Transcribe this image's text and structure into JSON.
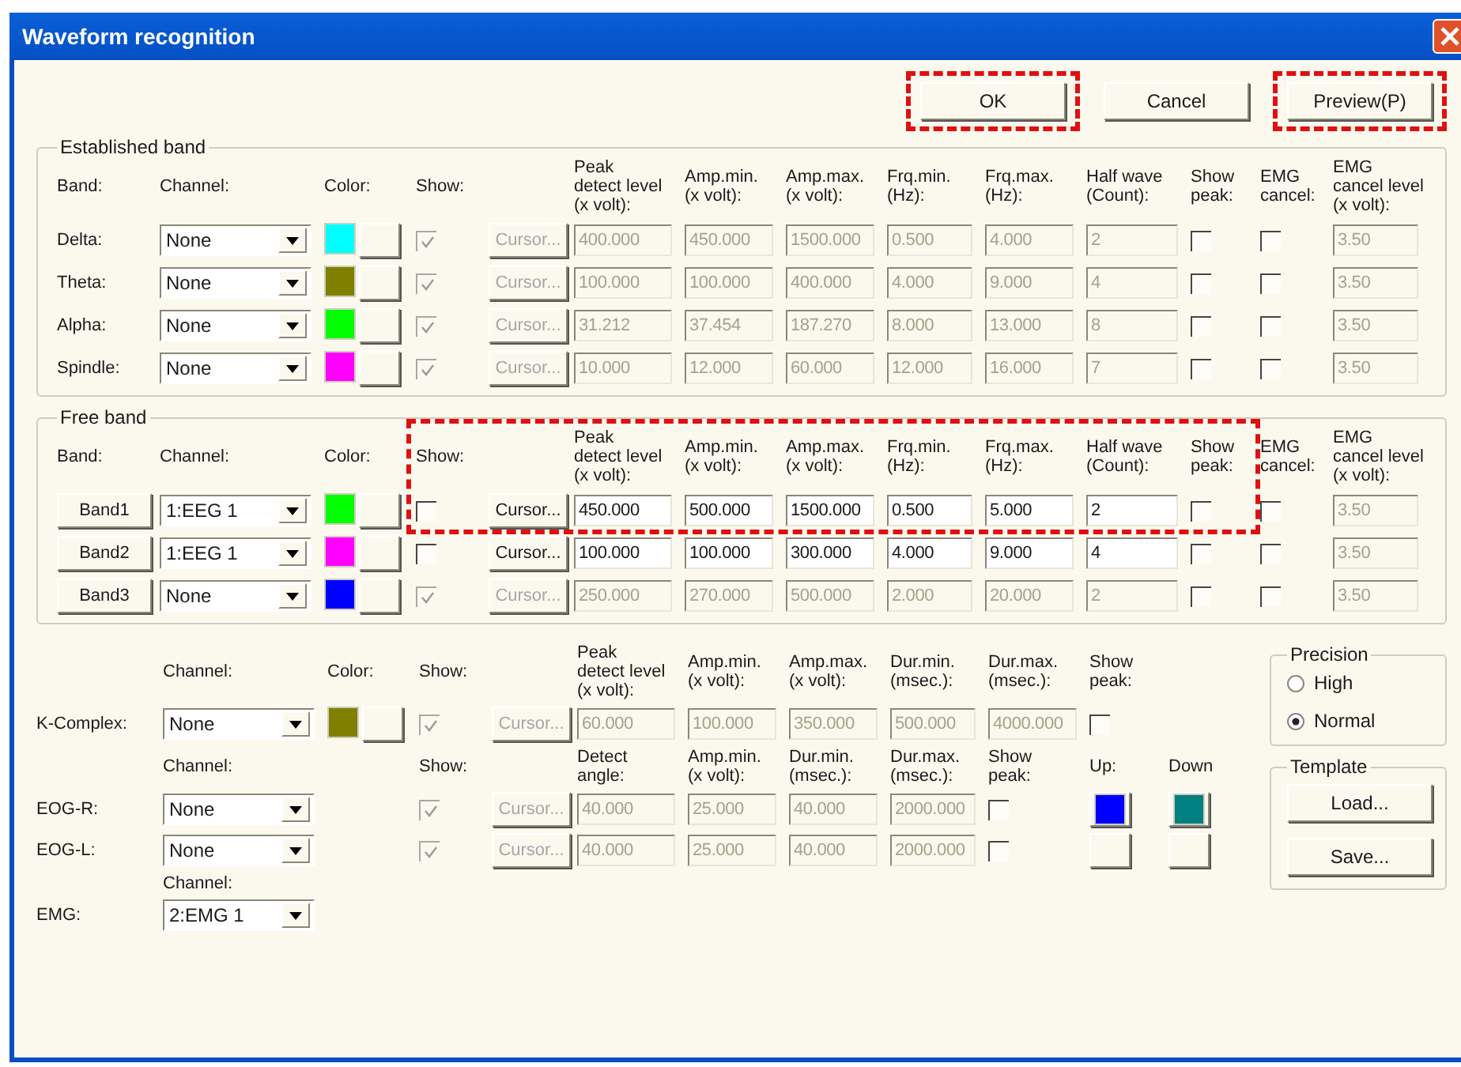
{
  "window": {
    "title": "Waveform recognition"
  },
  "buttons": [
    {
      "label": "OK",
      "highlighted": true
    },
    {
      "label": "Cancel",
      "highlighted": false
    },
    {
      "label": "Preview(P)",
      "highlighted": true
    }
  ],
  "established_band": {
    "title": "Established band",
    "rows": [
      [
        {
          "kind": "header",
          "text": "Band:"
        },
        {
          "kind": "header",
          "text": "Channel:"
        },
        {
          "kind": "header",
          "text": "Color:"
        },
        {
          "kind": "header",
          "text": "Show:"
        },
        {
          "kind": "blank"
        },
        {
          "kind": "header",
          "text": "Peak\ndetect level\n(x volt):"
        },
        {
          "kind": "header",
          "text": "Amp.min.\n(x volt):"
        },
        {
          "kind": "header",
          "text": "Amp.max.\n(x volt):"
        },
        {
          "kind": "header",
          "text": "Frq.min.\n(Hz):"
        },
        {
          "kind": "header",
          "text": "Frq.max.\n(Hz):"
        },
        {
          "kind": "header",
          "text": "Half wave\n(Count):"
        },
        {
          "kind": "header",
          "text": "Show\npeak:"
        },
        {
          "kind": "header",
          "text": "EMG\ncancel:"
        },
        {
          "kind": "header",
          "text": "EMG\ncancel level\n(x volt):"
        }
      ],
      [
        {
          "kind": "label",
          "text": "Delta:"
        },
        {
          "kind": "combo",
          "value": "None"
        },
        {
          "kind": "color",
          "color": "#00ffff"
        },
        {
          "kind": "check",
          "checked": true,
          "disabled": true
        },
        {
          "kind": "cursor",
          "text": "Cursor...",
          "disabled": true
        },
        {
          "kind": "field",
          "value": "400.000",
          "disabled": true
        },
        {
          "kind": "field",
          "value": "450.000",
          "disabled": true
        },
        {
          "kind": "field",
          "value": "1500.000",
          "disabled": true
        },
        {
          "kind": "field",
          "value": "0.500",
          "disabled": true
        },
        {
          "kind": "field",
          "value": "4.000",
          "disabled": true
        },
        {
          "kind": "field",
          "value": "2",
          "disabled": true
        },
        {
          "kind": "check",
          "checked": false,
          "disabled": false
        },
        {
          "kind": "check",
          "checked": false,
          "disabled": false
        },
        {
          "kind": "field",
          "value": "3.50",
          "disabled": true
        }
      ],
      [
        {
          "kind": "label",
          "text": "Theta:"
        },
        {
          "kind": "combo",
          "value": "None"
        },
        {
          "kind": "color",
          "color": "#808000"
        },
        {
          "kind": "check",
          "checked": true,
          "disabled": true
        },
        {
          "kind": "cursor",
          "text": "Cursor...",
          "disabled": true
        },
        {
          "kind": "field",
          "value": "100.000",
          "disabled": true
        },
        {
          "kind": "field",
          "value": "100.000",
          "disabled": true
        },
        {
          "kind": "field",
          "value": "400.000",
          "disabled": true
        },
        {
          "kind": "field",
          "value": "4.000",
          "disabled": true
        },
        {
          "kind": "field",
          "value": "9.000",
          "disabled": true
        },
        {
          "kind": "field",
          "value": "4",
          "disabled": true
        },
        {
          "kind": "check",
          "checked": false,
          "disabled": false
        },
        {
          "kind": "check",
          "checked": false,
          "disabled": false
        },
        {
          "kind": "field",
          "value": "3.50",
          "disabled": true
        }
      ],
      [
        {
          "kind": "label",
          "text": "Alpha:"
        },
        {
          "kind": "combo",
          "value": "None"
        },
        {
          "kind": "color",
          "color": "#00ff00"
        },
        {
          "kind": "check",
          "checked": true,
          "disabled": true
        },
        {
          "kind": "cursor",
          "text": "Cursor...",
          "disabled": true
        },
        {
          "kind": "field",
          "value": "31.212",
          "disabled": true
        },
        {
          "kind": "field",
          "value": "37.454",
          "disabled": true
        },
        {
          "kind": "field",
          "value": "187.270",
          "disabled": true
        },
        {
          "kind": "field",
          "value": "8.000",
          "disabled": true
        },
        {
          "kind": "field",
          "value": "13.000",
          "disabled": true
        },
        {
          "kind": "field",
          "value": "8",
          "disabled": true
        },
        {
          "kind": "check",
          "checked": false,
          "disabled": false
        },
        {
          "kind": "check",
          "checked": false,
          "disabled": false
        },
        {
          "kind": "field",
          "value": "3.50",
          "disabled": true
        }
      ],
      [
        {
          "kind": "label",
          "text": "Spindle:"
        },
        {
          "kind": "combo",
          "value": "None"
        },
        {
          "kind": "color",
          "color": "#ff00ff"
        },
        {
          "kind": "check",
          "checked": true,
          "disabled": true
        },
        {
          "kind": "cursor",
          "text": "Cursor...",
          "disabled": true
        },
        {
          "kind": "field",
          "value": "10.000",
          "disabled": true
        },
        {
          "kind": "field",
          "value": "12.000",
          "disabled": true
        },
        {
          "kind": "field",
          "value": "60.000",
          "disabled": true
        },
        {
          "kind": "field",
          "value": "12.000",
          "disabled": true
        },
        {
          "kind": "field",
          "value": "16.000",
          "disabled": true
        },
        {
          "kind": "field",
          "value": "7",
          "disabled": true
        },
        {
          "kind": "check",
          "checked": false,
          "disabled": false
        },
        {
          "kind": "check",
          "checked": false,
          "disabled": false
        },
        {
          "kind": "field",
          "value": "3.50",
          "disabled": true
        }
      ]
    ]
  },
  "free_band": {
    "title": "Free band",
    "highlighted": true,
    "rows": [
      [
        {
          "kind": "header",
          "text": "Band:"
        },
        {
          "kind": "header",
          "text": "Channel:"
        },
        {
          "kind": "header",
          "text": "Color:"
        },
        {
          "kind": "header",
          "text": "Show:"
        },
        {
          "kind": "blank"
        },
        {
          "kind": "header",
          "text": "Peak\ndetect level\n(x volt):"
        },
        {
          "kind": "header",
          "text": "Amp.min.\n(x volt):"
        },
        {
          "kind": "header",
          "text": "Amp.max.\n(x volt):"
        },
        {
          "kind": "header",
          "text": "Frq.min.\n(Hz):"
        },
        {
          "kind": "header",
          "text": "Frq.max.\n(Hz):"
        },
        {
          "kind": "header",
          "text": "Half wave\n(Count):"
        },
        {
          "kind": "header",
          "text": "Show\npeak:"
        },
        {
          "kind": "header",
          "text": "EMG\ncancel:"
        },
        {
          "kind": "header",
          "text": "EMG\ncancel level\n(x volt):"
        }
      ],
      [
        {
          "kind": "band_button",
          "text": "Band1"
        },
        {
          "kind": "combo",
          "value": "1:EEG 1"
        },
        {
          "kind": "color",
          "color": "#00ff00"
        },
        {
          "kind": "check",
          "checked": false,
          "disabled": false
        },
        {
          "kind": "cursor",
          "text": "Cursor...",
          "disabled": false
        },
        {
          "kind": "field",
          "value": "450.000",
          "disabled": false
        },
        {
          "kind": "field",
          "value": "500.000",
          "disabled": false
        },
        {
          "kind": "field",
          "value": "1500.000",
          "disabled": false
        },
        {
          "kind": "field",
          "value": "0.500",
          "disabled": false
        },
        {
          "kind": "field",
          "value": "5.000",
          "disabled": false
        },
        {
          "kind": "field",
          "value": "2",
          "disabled": false
        },
        {
          "kind": "check",
          "checked": false,
          "disabled": false
        },
        {
          "kind": "check",
          "checked": false,
          "disabled": false
        },
        {
          "kind": "field",
          "value": "3.50",
          "disabled": true
        }
      ],
      [
        {
          "kind": "band_button",
          "text": "Band2"
        },
        {
          "kind": "combo",
          "value": "1:EEG 1"
        },
        {
          "kind": "color",
          "color": "#ff00ff"
        },
        {
          "kind": "check",
          "checked": false,
          "disabled": false
        },
        {
          "kind": "cursor",
          "text": "Cursor...",
          "disabled": false
        },
        {
          "kind": "field",
          "value": "100.000",
          "disabled": false
        },
        {
          "kind": "field",
          "value": "100.000",
          "disabled": false
        },
        {
          "kind": "field",
          "value": "300.000",
          "disabled": false
        },
        {
          "kind": "field",
          "value": "4.000",
          "disabled": false
        },
        {
          "kind": "field",
          "value": "9.000",
          "disabled": false
        },
        {
          "kind": "field",
          "value": "4",
          "disabled": false
        },
        {
          "kind": "check",
          "checked": false,
          "disabled": false
        },
        {
          "kind": "check",
          "checked": false,
          "disabled": false
        },
        {
          "kind": "field",
          "value": "3.50",
          "disabled": true
        }
      ],
      [
        {
          "kind": "band_button",
          "text": "Band3"
        },
        {
          "kind": "combo",
          "value": "None"
        },
        {
          "kind": "color",
          "color": "#0000ff"
        },
        {
          "kind": "check",
          "checked": true,
          "disabled": true
        },
        {
          "kind": "cursor",
          "text": "Cursor...",
          "disabled": true
        },
        {
          "kind": "field",
          "value": "250.000",
          "disabled": true
        },
        {
          "kind": "field",
          "value": "270.000",
          "disabled": true
        },
        {
          "kind": "field",
          "value": "500.000",
          "disabled": true
        },
        {
          "kind": "field",
          "value": "2.000",
          "disabled": true
        },
        {
          "kind": "field",
          "value": "20.000",
          "disabled": true
        },
        {
          "kind": "field",
          "value": "2",
          "disabled": true
        },
        {
          "kind": "check",
          "checked": false,
          "disabled": false
        },
        {
          "kind": "check",
          "checked": false,
          "disabled": false
        },
        {
          "kind": "field",
          "value": "3.50",
          "disabled": true
        }
      ]
    ]
  },
  "other": {
    "rows": [
      [
        {
          "kind": "blank"
        },
        {
          "kind": "header",
          "text": "Channel:"
        },
        {
          "kind": "header",
          "text": "Color:"
        },
        {
          "kind": "header",
          "text": "Show:"
        },
        {
          "kind": "blank"
        },
        {
          "kind": "header",
          "text": "Peak\ndetect level\n(x volt):"
        },
        {
          "kind": "header",
          "text": "Amp.min.\n(x volt):"
        },
        {
          "kind": "header",
          "text": "Amp.max.\n(x volt):"
        },
        {
          "kind": "header",
          "text": "Dur.min.\n(msec.):"
        },
        {
          "kind": "header",
          "text": "Dur.max.\n(msec.):"
        },
        {
          "kind": "header",
          "text": "Show\npeak:"
        }
      ],
      [
        {
          "kind": "label",
          "text": "K-Complex:"
        },
        {
          "kind": "combo",
          "value": "None"
        },
        {
          "kind": "color",
          "color": "#808000"
        },
        {
          "kind": "check",
          "checked": true,
          "disabled": true
        },
        {
          "kind": "cursor",
          "text": "Cursor...",
          "disabled": true
        },
        {
          "kind": "field",
          "value": "60.000",
          "disabled": true
        },
        {
          "kind": "field",
          "value": "100.000",
          "disabled": true
        },
        {
          "kind": "field",
          "value": "350.000",
          "disabled": true
        },
        {
          "kind": "field",
          "value": "500.000",
          "disabled": true
        },
        {
          "kind": "field",
          "value": "4000.000",
          "disabled": true
        },
        {
          "kind": "check",
          "checked": false,
          "disabled": false
        }
      ],
      [
        {
          "kind": "blank"
        },
        {
          "kind": "header",
          "text": "Channel:"
        },
        {
          "kind": "blank"
        },
        {
          "kind": "header",
          "text": "Show:"
        },
        {
          "kind": "blank"
        },
        {
          "kind": "header",
          "text": "Detect\nangle:"
        },
        {
          "kind": "header",
          "text": "Amp.min.\n(x volt):"
        },
        {
          "kind": "header",
          "text": "Dur.min.\n(msec.):"
        },
        {
          "kind": "header",
          "text": "Dur.max.\n(msec.):"
        },
        {
          "kind": "header",
          "text": "Show\npeak:"
        },
        {
          "kind": "header",
          "text": "Up:"
        },
        {
          "kind": "header",
          "text": "Down"
        }
      ],
      [
        {
          "kind": "label",
          "text": "EOG-R:"
        },
        {
          "kind": "combo",
          "value": "None"
        },
        {
          "kind": "blank"
        },
        {
          "kind": "check",
          "checked": true,
          "disabled": true
        },
        {
          "kind": "cursor",
          "text": "Cursor...",
          "disabled": true
        },
        {
          "kind": "field",
          "value": "40.000",
          "disabled": true
        },
        {
          "kind": "field",
          "value": "25.000",
          "disabled": true
        },
        {
          "kind": "field",
          "value": "40.000",
          "disabled": true
        },
        {
          "kind": "field",
          "value": "2000.000",
          "disabled": true
        },
        {
          "kind": "check",
          "checked": false,
          "disabled": false
        },
        {
          "kind": "swatch",
          "color": "#0000ff"
        },
        {
          "kind": "swatch",
          "color": "#008080"
        }
      ],
      [
        {
          "kind": "label",
          "text": "EOG-L:"
        },
        {
          "kind": "combo",
          "value": "None"
        },
        {
          "kind": "blank"
        },
        {
          "kind": "check",
          "checked": true,
          "disabled": true
        },
        {
          "kind": "cursor",
          "text": "Cursor...",
          "disabled": true
        },
        {
          "kind": "field",
          "value": "40.000",
          "disabled": true
        },
        {
          "kind": "field",
          "value": "25.000",
          "disabled": true
        },
        {
          "kind": "field",
          "value": "40.000",
          "disabled": true
        },
        {
          "kind": "field",
          "value": "2000.000",
          "disabled": true
        },
        {
          "kind": "check",
          "checked": false,
          "disabled": false
        },
        {
          "kind": "empty_button"
        },
        {
          "kind": "empty_button"
        }
      ],
      [
        {
          "kind": "blank"
        },
        {
          "kind": "header",
          "text": "Channel:"
        }
      ],
      [
        {
          "kind": "label",
          "text": "EMG:"
        },
        {
          "kind": "combo",
          "value": "2:EMG 1"
        }
      ]
    ]
  },
  "precision": {
    "title": "Precision",
    "options": [
      {
        "label": "High",
        "selected": false
      },
      {
        "label": "Normal",
        "selected": true
      }
    ]
  },
  "template": {
    "title": "Template",
    "buttons": [
      "Load...",
      "Save..."
    ]
  }
}
